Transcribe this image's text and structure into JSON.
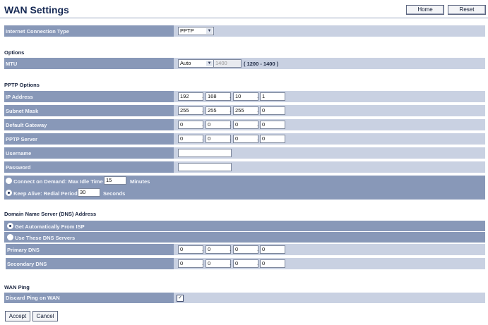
{
  "page": {
    "title": "WAN Settings",
    "home_label": "Home",
    "reset_label": "Reset"
  },
  "connection": {
    "label": "Internet Connection Type",
    "value": "PPTP"
  },
  "options": {
    "section": "Options",
    "mtu_label": "MTU",
    "mtu_mode": "Auto",
    "mtu_value": "1400",
    "mtu_range": "( 1200 - 1400 )"
  },
  "pptp": {
    "section": "PPTP Options",
    "ip_label": "IP Address",
    "ip": [
      "192",
      "168",
      "10",
      "1"
    ],
    "mask_label": "Subnet Mask",
    "mask": [
      "255",
      "255",
      "255",
      "0"
    ],
    "gw_label": "Default Gateway",
    "gw": [
      "0",
      "0",
      "0",
      "0"
    ],
    "server_label": "PPTP Server",
    "server": [
      "0",
      "0",
      "0",
      "0"
    ],
    "username_label": "Username",
    "username": "",
    "password_label": "Password",
    "password": "",
    "cod_label": "Connect on Demand: Max Idle Time",
    "cod_value": "15",
    "cod_unit": "Minutes",
    "ka_label": "Keep Alive: Redial Period",
    "ka_value": "30",
    "ka_unit": "Seconds"
  },
  "dns": {
    "section": "Domain Name Server (DNS) Address",
    "auto_label": "Get Automatically From ISP",
    "manual_label": "Use These DNS Servers",
    "primary_label": "Primary DNS",
    "primary": [
      "0",
      "0",
      "0",
      "0"
    ],
    "secondary_label": "Secondary DNS",
    "secondary": [
      "0",
      "0",
      "0",
      "0"
    ]
  },
  "wanping": {
    "section": "WAN Ping",
    "discard_label": "Discard Ping on WAN",
    "discard_checked": true
  },
  "actions": {
    "accept_label": "Accept",
    "cancel_label": "Cancel"
  }
}
